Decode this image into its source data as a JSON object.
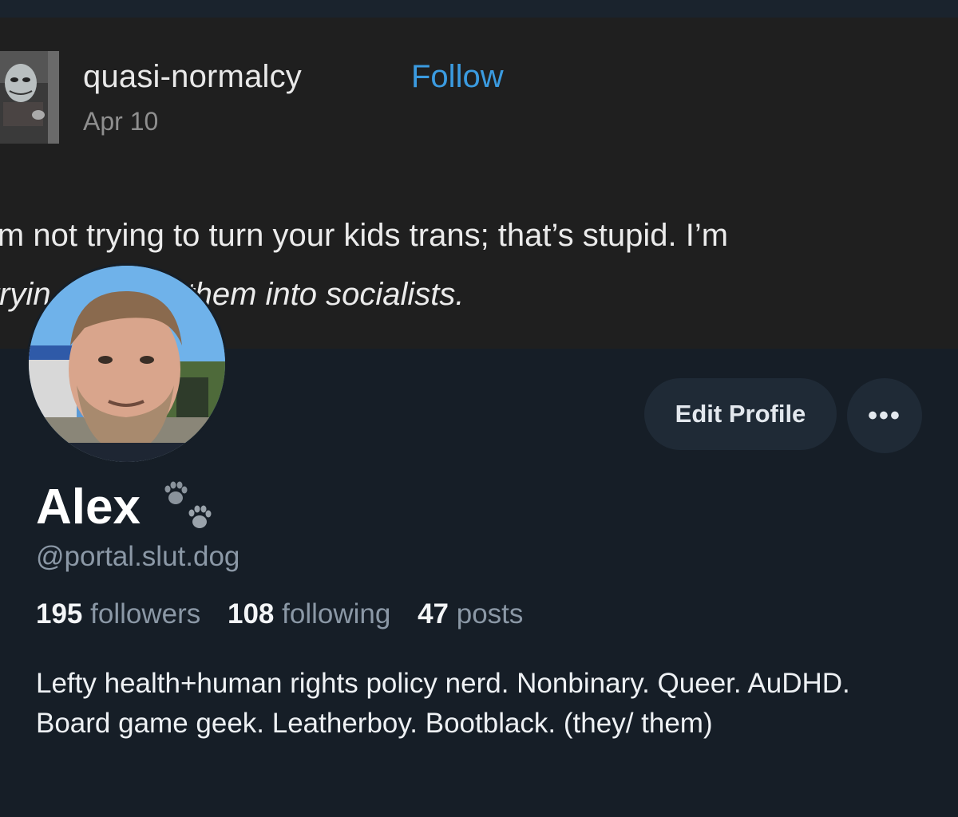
{
  "post_banner": {
    "username": "quasi-normalcy",
    "follow_label": "Follow",
    "date": "Apr 10",
    "text_line1": "’m not trying to turn your kids trans; that’s stupid. I’m",
    "text_line2": "tryin           rn them into socialists."
  },
  "profile": {
    "display_name": "Alex",
    "handle": "@portal.slut.dog",
    "edit_button_label": "Edit Profile",
    "more_button_label": "•••",
    "stats": [
      {
        "count": "195",
        "label": "followers"
      },
      {
        "count": "108",
        "label": "following"
      },
      {
        "count": "47",
        "label": "posts"
      }
    ],
    "bio": "Lefty health+human rights policy nerd. Nonbinary. Queer. AuDHD. Board game geek. Leatherboy. Bootblack. (they/ them)"
  },
  "icons": {
    "name_badge": "paw-prints-icon",
    "more": "ellipsis-icon"
  },
  "colors": {
    "background": "#161e27",
    "banner_background": "#1f1f1f",
    "follow_link": "#3b9be0",
    "button_background": "#1f2a36",
    "secondary_text": "#8b98a6"
  }
}
